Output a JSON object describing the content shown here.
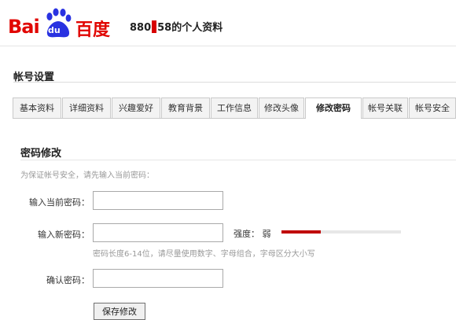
{
  "header": {
    "logo_bai": "Bai",
    "logo_du": "du",
    "logo_cn": "百度",
    "title_prefix": "880",
    "title_suffix": "58的个人资料"
  },
  "section": {
    "title": "帐号设置"
  },
  "tabs": [
    {
      "label": "基本资料"
    },
    {
      "label": "详细资料"
    },
    {
      "label": "兴趣爱好"
    },
    {
      "label": "教育背景"
    },
    {
      "label": "工作信息"
    },
    {
      "label": "修改头像"
    },
    {
      "label": "修改密码",
      "active": true
    },
    {
      "label": "帐号关联"
    },
    {
      "label": "帐号安全"
    }
  ],
  "panel": {
    "title": "密码修改",
    "hint": "为保证帐号安全，请先输入当前密码：",
    "current_password_label": "输入当前密码：",
    "new_password_label": "输入新密码：",
    "confirm_password_label": "确认密码：",
    "strength_label": "强度：  弱",
    "strength_level": 0.33,
    "password_hint": "密码长度6-14位，请尽量使用数字、字母组合，字母区分大小写",
    "save_button": "保存修改"
  },
  "colors": {
    "brand_red": "#e10602",
    "strength_weak": "#c00000"
  }
}
